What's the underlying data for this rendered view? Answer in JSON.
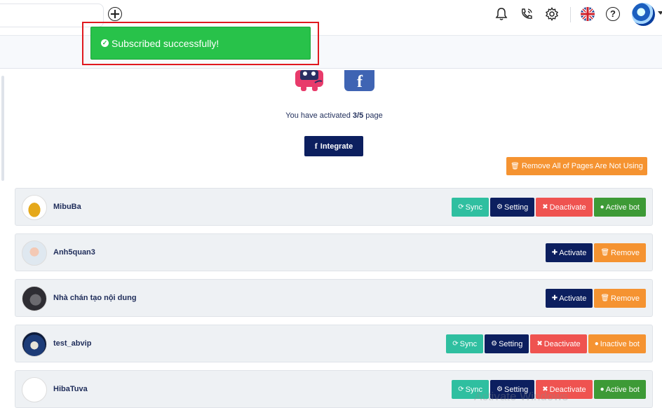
{
  "toast": {
    "message": "Subscribed successfully!"
  },
  "header": {
    "icons": [
      "add-icon",
      "bell-icon",
      "phone-icon",
      "gear-icon",
      "uk-flag-icon",
      "help-icon",
      "user-avatar"
    ],
    "help_glyph": "?"
  },
  "summary": {
    "prefix": "You have activated ",
    "count": "3/5",
    "suffix": " page"
  },
  "integrate_label": "Integrate",
  "remove_all_label": "Remove All of Pages Are Not Using",
  "pages": [
    {
      "name": "MibuBa",
      "buttons": [
        "Sync",
        "Setting",
        "Deactivate",
        "Active bot"
      ]
    },
    {
      "name": "Anh5quan3",
      "buttons": [
        "Activate",
        "Remove"
      ]
    },
    {
      "name": "Nhà chán tạo nội dung",
      "buttons": [
        "Activate",
        "Remove"
      ]
    },
    {
      "name": "test_abvip",
      "buttons": [
        "Sync",
        "Setting",
        "Deactivate",
        "Inactive bot"
      ]
    },
    {
      "name": "HibaTuva",
      "buttons": [
        "Sync",
        "Setting",
        "Deactivate",
        "Active bot"
      ]
    }
  ],
  "watermark": "Activate Windows",
  "colors": {
    "toast": "#28c24a",
    "navy": "#0c1f5f",
    "orange": "#f59331",
    "teal": "#2fbfa0",
    "red": "#ef5350",
    "green": "#3d9a36"
  }
}
